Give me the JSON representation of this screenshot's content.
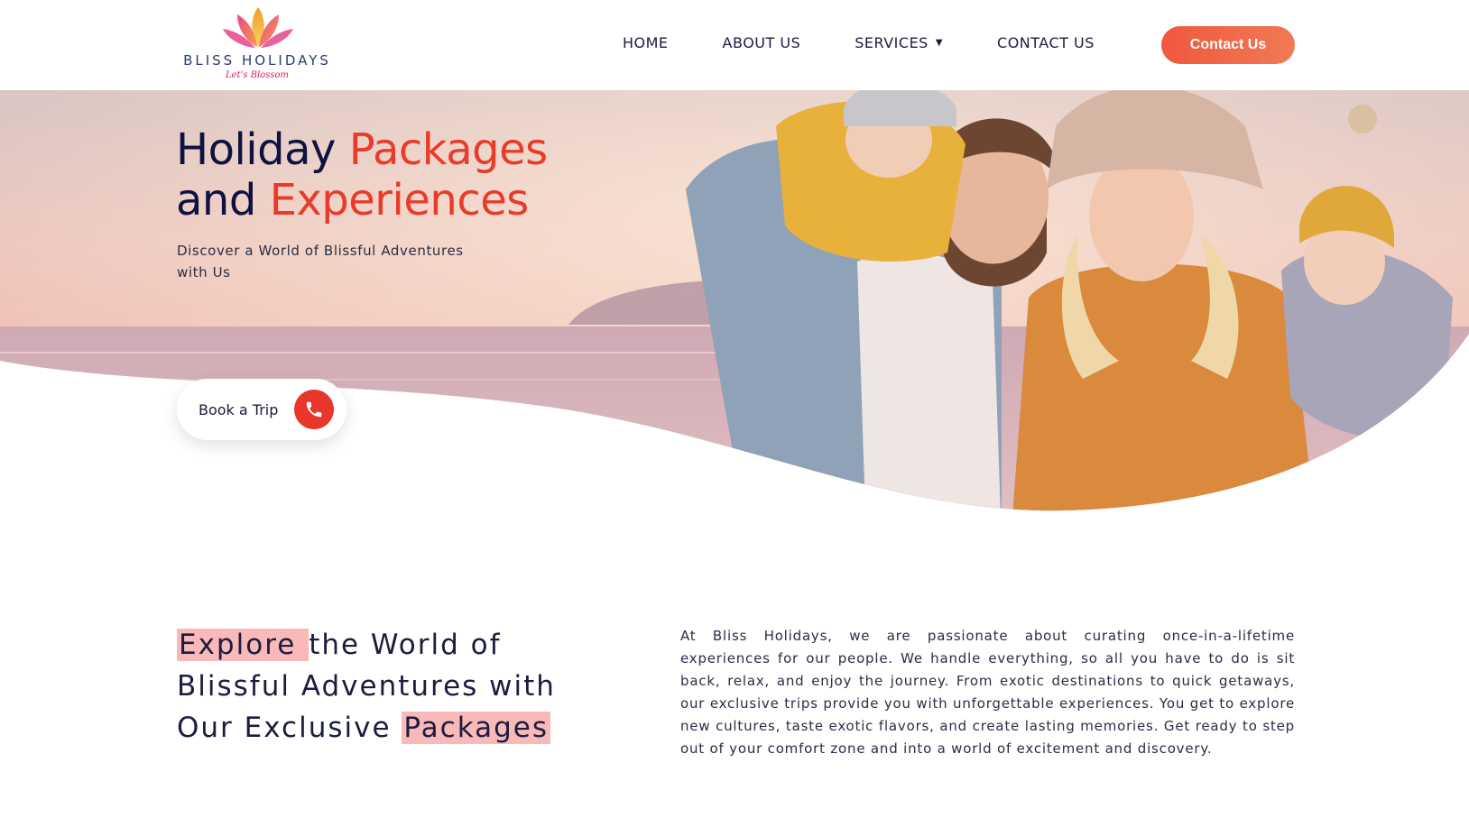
{
  "brand": {
    "name": "BLISS HOLIDAYS",
    "tagline": "Let's Blossom"
  },
  "nav": {
    "items": [
      {
        "label": "HOME"
      },
      {
        "label": "ABOUT US"
      },
      {
        "label": "SERVICES"
      },
      {
        "label": "CONTACT US"
      }
    ],
    "cta_label": "Contact Us"
  },
  "hero": {
    "title_part1": "Holiday ",
    "title_accent1": "Packages",
    "title_part2": "and ",
    "title_accent2": "Experiences",
    "subtitle": "Discover a World of Blissful Adventures with Us",
    "book_label": "Book a Trip"
  },
  "explore": {
    "hl1": "Explore ",
    "text1": "the World of Blissful Adventures with Our Exclusive ",
    "hl2": "Packages",
    "paragraph": "At Bliss Holidays, we are passionate about curating once-in-a-lifetime experiences for our people. We handle everything, so all you have to do is sit back, relax, and enjoy the journey. From exotic destinations to quick getaways, our exclusive trips provide you with unforgettable experiences. You get to explore new cultures, taste exotic flavors, and create lasting memories. Get ready to step out of your comfort zone and into a world of excitement and discovery."
  },
  "colors": {
    "accent": "#ea3b29",
    "button": "#f0583d",
    "navy": "#0f1240",
    "highlight": "#f9b9b9"
  }
}
